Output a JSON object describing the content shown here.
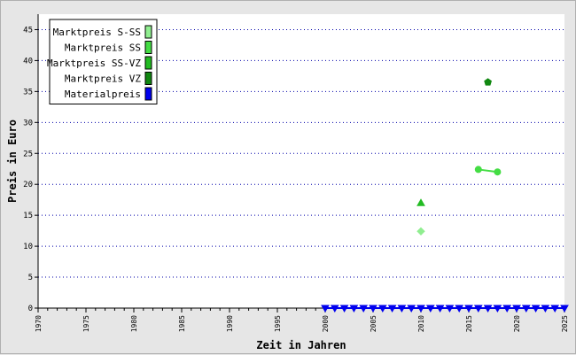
{
  "chart_data": {
    "type": "scatter",
    "xlabel": "Zeit in Jahren",
    "ylabel": "Preis in Euro",
    "xlim": [
      1970,
      2025
    ],
    "ylim": [
      0,
      47.5
    ],
    "x_ticks": [
      1970,
      1975,
      1980,
      1985,
      1990,
      1995,
      2000,
      2005,
      2010,
      2015,
      2020,
      2025
    ],
    "y_ticks": [
      0,
      5,
      10,
      15,
      20,
      25,
      30,
      35,
      40,
      45
    ],
    "grid": "horizontal dotted",
    "legend_position": "top-left",
    "series": [
      {
        "name": "Marktpreis S-SS",
        "color": "#90ee90",
        "marker": "diamond",
        "line": false,
        "points": [
          [
            2010,
            12.4
          ]
        ]
      },
      {
        "name": "Marktpreis SS",
        "color": "#44dd44",
        "marker": "circle",
        "line": true,
        "points": [
          [
            2016,
            22.4
          ],
          [
            2018,
            22.0
          ]
        ]
      },
      {
        "name": "Marktpreis SS-VZ",
        "color": "#22bb22",
        "marker": "triangle-up",
        "line": false,
        "points": [
          [
            2010,
            17.0
          ]
        ]
      },
      {
        "name": "Marktpreis VZ",
        "color": "#118811",
        "marker": "pentagon",
        "line": false,
        "points": [
          [
            2017,
            36.5
          ]
        ]
      },
      {
        "name": "Materialpreis",
        "color": "#0000ee",
        "marker": "triangle-down",
        "line": true,
        "points": [
          [
            2000,
            0
          ],
          [
            2001,
            0
          ],
          [
            2002,
            0
          ],
          [
            2003,
            0
          ],
          [
            2004,
            0
          ],
          [
            2005,
            0
          ],
          [
            2006,
            0
          ],
          [
            2007,
            0
          ],
          [
            2008,
            0
          ],
          [
            2009,
            0
          ],
          [
            2010,
            0
          ],
          [
            2011,
            0
          ],
          [
            2012,
            0
          ],
          [
            2013,
            0
          ],
          [
            2014,
            0
          ],
          [
            2015,
            0
          ],
          [
            2016,
            0
          ],
          [
            2017,
            0
          ],
          [
            2018,
            0
          ],
          [
            2019,
            0
          ],
          [
            2020,
            0
          ],
          [
            2021,
            0
          ],
          [
            2022,
            0
          ],
          [
            2023,
            0
          ],
          [
            2024,
            0
          ],
          [
            2025,
            0
          ]
        ]
      }
    ]
  }
}
